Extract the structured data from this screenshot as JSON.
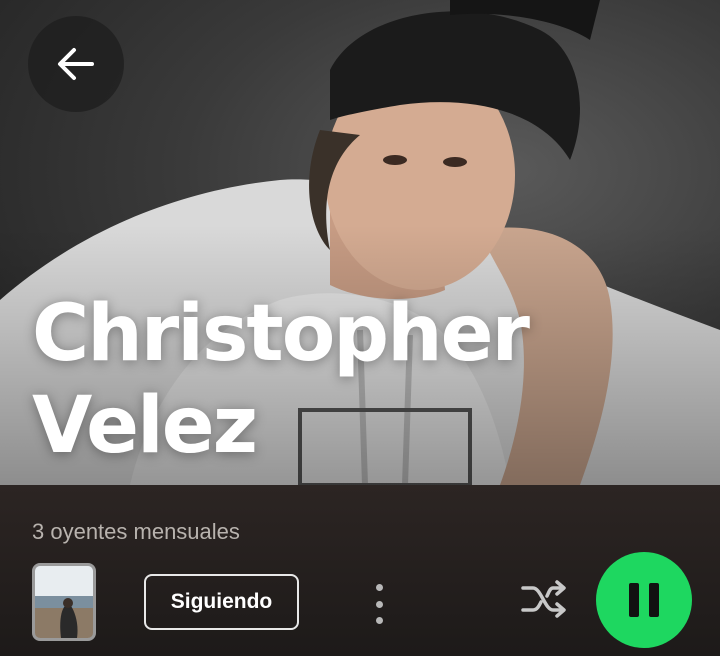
{
  "artist": {
    "name_line1": "Christopher",
    "name_line2": "Velez",
    "monthly_listeners": "3 oyentes mensuales"
  },
  "actions": {
    "follow_label": "Siguiendo"
  },
  "icons": {
    "back": "arrow-left-icon",
    "more": "more-vertical-icon",
    "shuffle": "shuffle-icon",
    "pause": "pause-icon"
  },
  "colors": {
    "accent": "#1ed760",
    "background": "#121212"
  }
}
